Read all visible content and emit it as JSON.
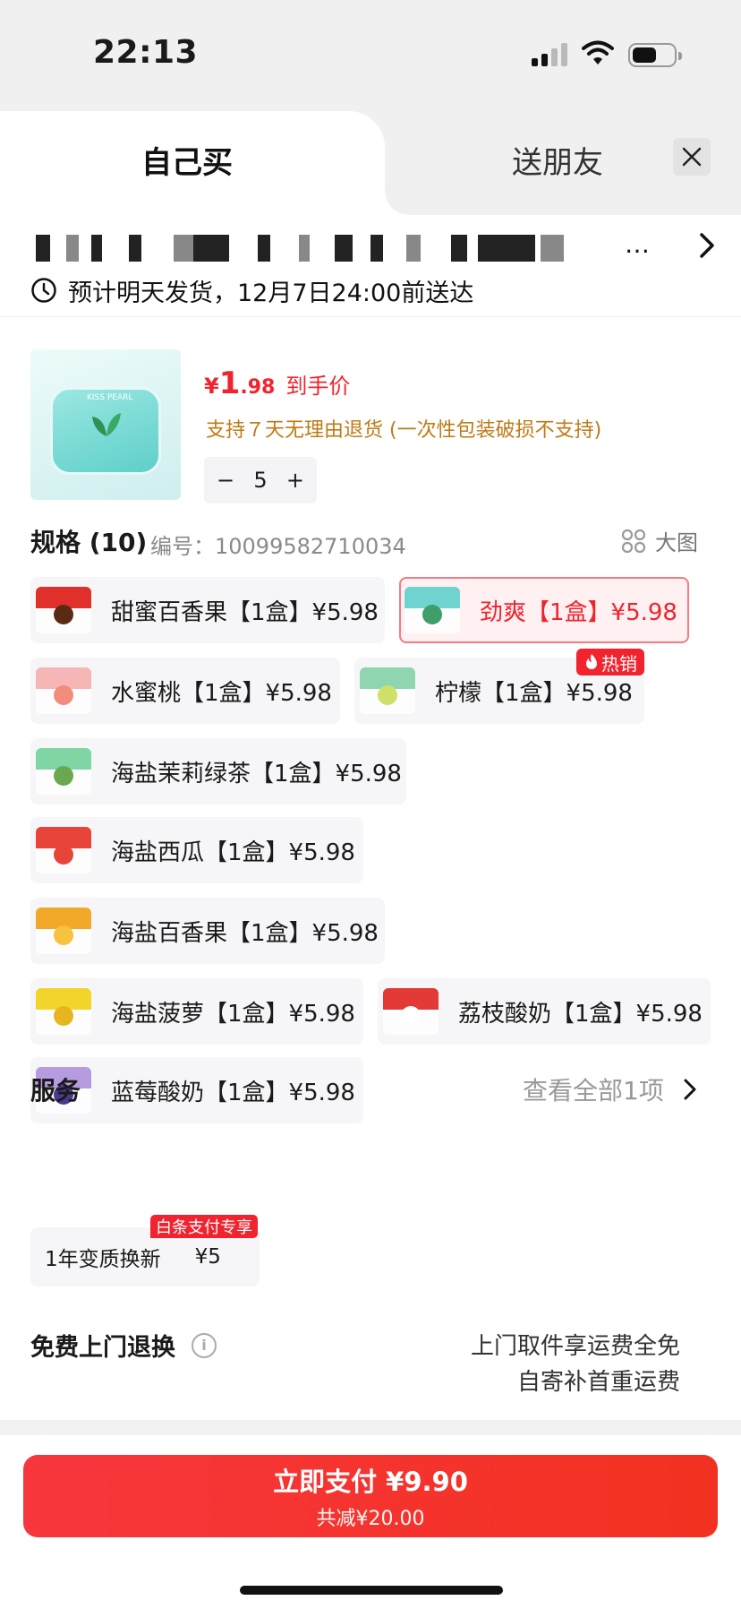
{
  "status_bar": {
    "time": "22:13"
  },
  "tabs": {
    "buy_self": "自己买",
    "gift_friend": "送朋友"
  },
  "address": {
    "ellipsis": "…"
  },
  "delivery": {
    "text": "预计明天发货，12月7日24:00前送达"
  },
  "product": {
    "tin_brand": "KISS PEARL",
    "price_yen": "¥",
    "price_int": "1",
    "price_dec": ".98",
    "price_suffix": "到手价",
    "return_policy": "支持７天无理由退货 (一次性包装破损不支持)",
    "quantity": "5"
  },
  "spec": {
    "title": "规格 (10)",
    "code": "编号：10099582710034",
    "big_image": "大图",
    "hot_badge": "热销",
    "items": [
      {
        "label": "甜蜜百香果【1盒】¥5.98",
        "color": "#e0302c",
        "fruit": "#5a2a14"
      },
      {
        "label": "劲爽【1盒】¥5.98",
        "color": "#6fd4cf",
        "fruit": "#3f9e6a",
        "selected": true
      },
      {
        "label": "水蜜桃【1盒】¥5.98",
        "color": "#f6b6b6",
        "fruit": "#f28d7b"
      },
      {
        "label": "柠檬【1盒】¥5.98",
        "color": "#8fd6b0",
        "fruit": "#cfe06a"
      },
      {
        "label": "海盐茉莉绿茶【1盒】¥5.98",
        "color": "#7fd6a4",
        "fruit": "#6aa84f"
      },
      {
        "label": "海盐西瓜【1盒】¥5.98",
        "color": "#e8443a",
        "fruit": "#e8443a"
      },
      {
        "label": "海盐百香果【1盒】¥5.98",
        "color": "#f2a829",
        "fruit": "#f6c23f"
      },
      {
        "label": "海盐菠萝【1盒】¥5.98",
        "color": "#f3d42a",
        "fruit": "#e7b51e"
      },
      {
        "label": "荔枝酸奶【1盒】¥5.98",
        "color": "#e33a36",
        "fruit": "#ffffff"
      },
      {
        "label": "蓝莓酸奶【1盒】¥5.98",
        "color": "#b79be0",
        "fruit": "#4d3a8f"
      }
    ]
  },
  "service": {
    "title": "服务",
    "view_all": "查看全部1项",
    "card_name": "1年变质换新",
    "card_price": "¥5",
    "badge": "白条支付专享"
  },
  "free_return": {
    "title": "免费上门退换",
    "line1": "上门取件享运费全免",
    "line2": "自寄补首重运费"
  },
  "pay": {
    "main": "立即支付 ¥9.90",
    "sub": "共减¥20.00"
  },
  "colors": {
    "accent": "#f1232f",
    "policy": "#c07a16"
  }
}
